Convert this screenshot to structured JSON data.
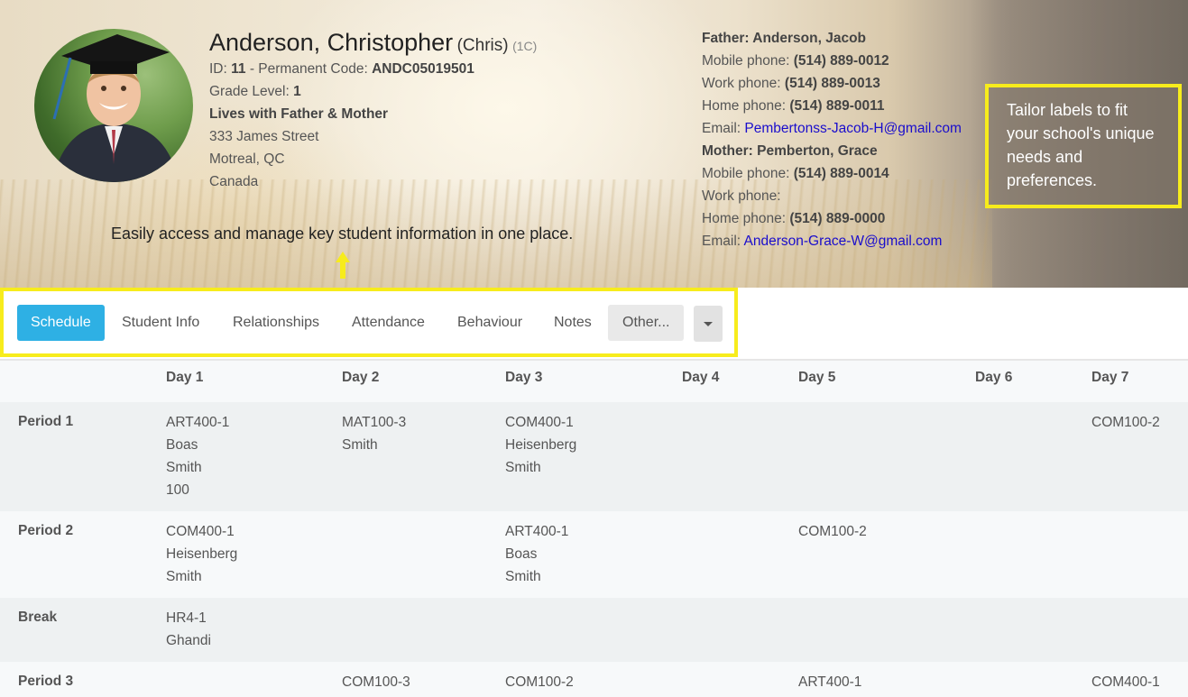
{
  "student": {
    "name": "Anderson, Christopher",
    "nickname": "(Chris)",
    "grade_code": "(1C)",
    "id_label": "ID: ",
    "id": "11",
    "permanent_code_label": " - Permanent Code: ",
    "permanent_code": "ANDC05019501",
    "grade_level_label": "Grade Level: ",
    "grade_level": "1",
    "lives_with": "Lives with Father & Mother",
    "address": [
      "333 James Street",
      "Motreal, QC",
      "Canada"
    ]
  },
  "tagline": "Easily access and manage key student information in one place.",
  "callout": "Tailor labels to fit your school's unique needs and preferences.",
  "father": {
    "heading": "Father: Anderson, Jacob",
    "mobile_label": "Mobile phone: ",
    "mobile": "(514) 889-0012",
    "work_label": "Work phone: ",
    "work": "(514) 889-0013",
    "home_label": "Home phone: ",
    "home": "(514) 889-0011",
    "email_label": "Email: ",
    "email": "Pembertonss-Jacob-H@gmail.com"
  },
  "mother": {
    "heading": "Mother: Pemberton, Grace",
    "mobile_label": "Mobile phone: ",
    "mobile": "(514) 889-0014",
    "work_label": "Work phone: ",
    "work": "",
    "home_label": "Home phone: ",
    "home": "(514) 889-0000",
    "email_label": "Email: ",
    "email": "Anderson-Grace-W@gmail.com"
  },
  "tabs": [
    "Schedule",
    "Student Info",
    "Relationships",
    "Attendance",
    "Behaviour",
    "Notes",
    "Other..."
  ],
  "schedule": {
    "days": [
      "Day 1",
      "Day 2",
      "Day 3",
      "Day 4",
      "Day 5",
      "Day 6",
      "Day 7"
    ],
    "periods": [
      {
        "label": "Period 1",
        "cells": [
          [
            "ART400-1",
            "Boas",
            "Smith",
            "100"
          ],
          [
            "MAT100-3",
            "Smith"
          ],
          [
            "COM400-1",
            "Heisenberg",
            "Smith"
          ],
          [],
          [],
          [],
          [
            "COM100-2"
          ]
        ]
      },
      {
        "label": "Period 2",
        "cells": [
          [
            "COM400-1",
            "Heisenberg",
            "Smith"
          ],
          [],
          [
            "ART400-1",
            "Boas",
            "Smith"
          ],
          [],
          [
            "COM100-2"
          ],
          [],
          []
        ]
      },
      {
        "label": "Break",
        "cells": [
          [
            "HR4-1",
            "Ghandi"
          ],
          [],
          [],
          [],
          [],
          [],
          []
        ]
      },
      {
        "label": "Period 3",
        "cells": [
          [],
          [
            "COM100-3"
          ],
          [
            "COM100-2"
          ],
          [],
          [
            "ART400-1"
          ],
          [],
          [
            "COM400-1"
          ]
        ]
      }
    ]
  },
  "colors": {
    "accent": "#2eb0e4",
    "highlight": "#f7ec1c",
    "link": "#1a0dcc"
  }
}
